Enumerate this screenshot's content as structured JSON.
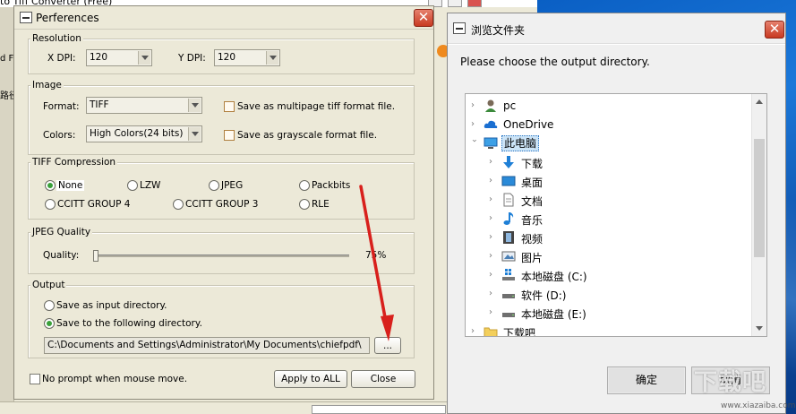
{
  "background_app": {
    "title": "to Tiff Converter (Free)",
    "left_fragment_1": "d F",
    "left_fragment_2": "路径"
  },
  "preferences": {
    "title": "Perferences",
    "resolution": {
      "legend": "Resolution",
      "x_dpi_label": "X DPI:",
      "x_dpi_value": "120",
      "y_dpi_label": "Y DPI:",
      "y_dpi_value": "120"
    },
    "image": {
      "legend": "Image",
      "format_label": "Format:",
      "format_value": "TIFF",
      "colors_label": "Colors:",
      "colors_value": "High Colors(24 bits)",
      "multipage_label": "Save as multipage tiff format file.",
      "grayscale_label": "Save as grayscale format file."
    },
    "compression": {
      "legend": "TIFF Compression",
      "options": [
        "None",
        "LZW",
        "JPEG",
        "Packbits",
        "CCITT GROUP 4",
        "CCITT GROUP 3",
        "RLE"
      ],
      "selected": "None"
    },
    "jpeg": {
      "legend": "JPEG Quality",
      "quality_label": "Quality:",
      "quality_value": "75%",
      "quality_fraction": 0.75
    },
    "output": {
      "legend": "Output",
      "option_input_dir": "Save as input directory.",
      "option_following_dir": "Save to the following directory.",
      "path": "C:\\Documents and Settings\\Administrator\\My Documents\\chiefpdf\\",
      "browse_label": "..."
    },
    "no_prompt_label": "No prompt when mouse move.",
    "apply_all_label": "Apply to ALL",
    "close_label": "Close"
  },
  "browse_dialog": {
    "title": "浏览文件夹",
    "instruction": "Please choose the output directory.",
    "tree": [
      {
        "label": "pc",
        "icon": "person-icon",
        "level": 0
      },
      {
        "label": "OneDrive",
        "icon": "cloud-icon",
        "level": 0
      },
      {
        "label": "此电脑",
        "icon": "monitor-icon",
        "level": 0,
        "selected": true,
        "expanded": true
      },
      {
        "label": "下载",
        "icon": "download-arrow-icon",
        "level": 1
      },
      {
        "label": "桌面",
        "icon": "desktop-icon",
        "level": 1
      },
      {
        "label": "文档",
        "icon": "document-icon",
        "level": 1
      },
      {
        "label": "音乐",
        "icon": "music-note-icon",
        "level": 1
      },
      {
        "label": "视频",
        "icon": "film-icon",
        "level": 1
      },
      {
        "label": "图片",
        "icon": "picture-icon",
        "level": 1
      },
      {
        "label": "本地磁盘 (C:)",
        "icon": "windows-drive-icon",
        "level": 1
      },
      {
        "label": "软件 (D:)",
        "icon": "drive-icon",
        "level": 1
      },
      {
        "label": "本地磁盘 (E:)",
        "icon": "drive-icon",
        "level": 1
      },
      {
        "label": "下载吧",
        "icon": "folder-icon",
        "level": 0
      }
    ],
    "ok_label": "确定",
    "cancel_label": "取消"
  },
  "watermark": {
    "text": "下载吧",
    "sub": "www.xiazaiba.com"
  },
  "colors": {
    "arrow": "#d8201c",
    "selection": "#cce4f7",
    "close_button": "#c83a22"
  }
}
